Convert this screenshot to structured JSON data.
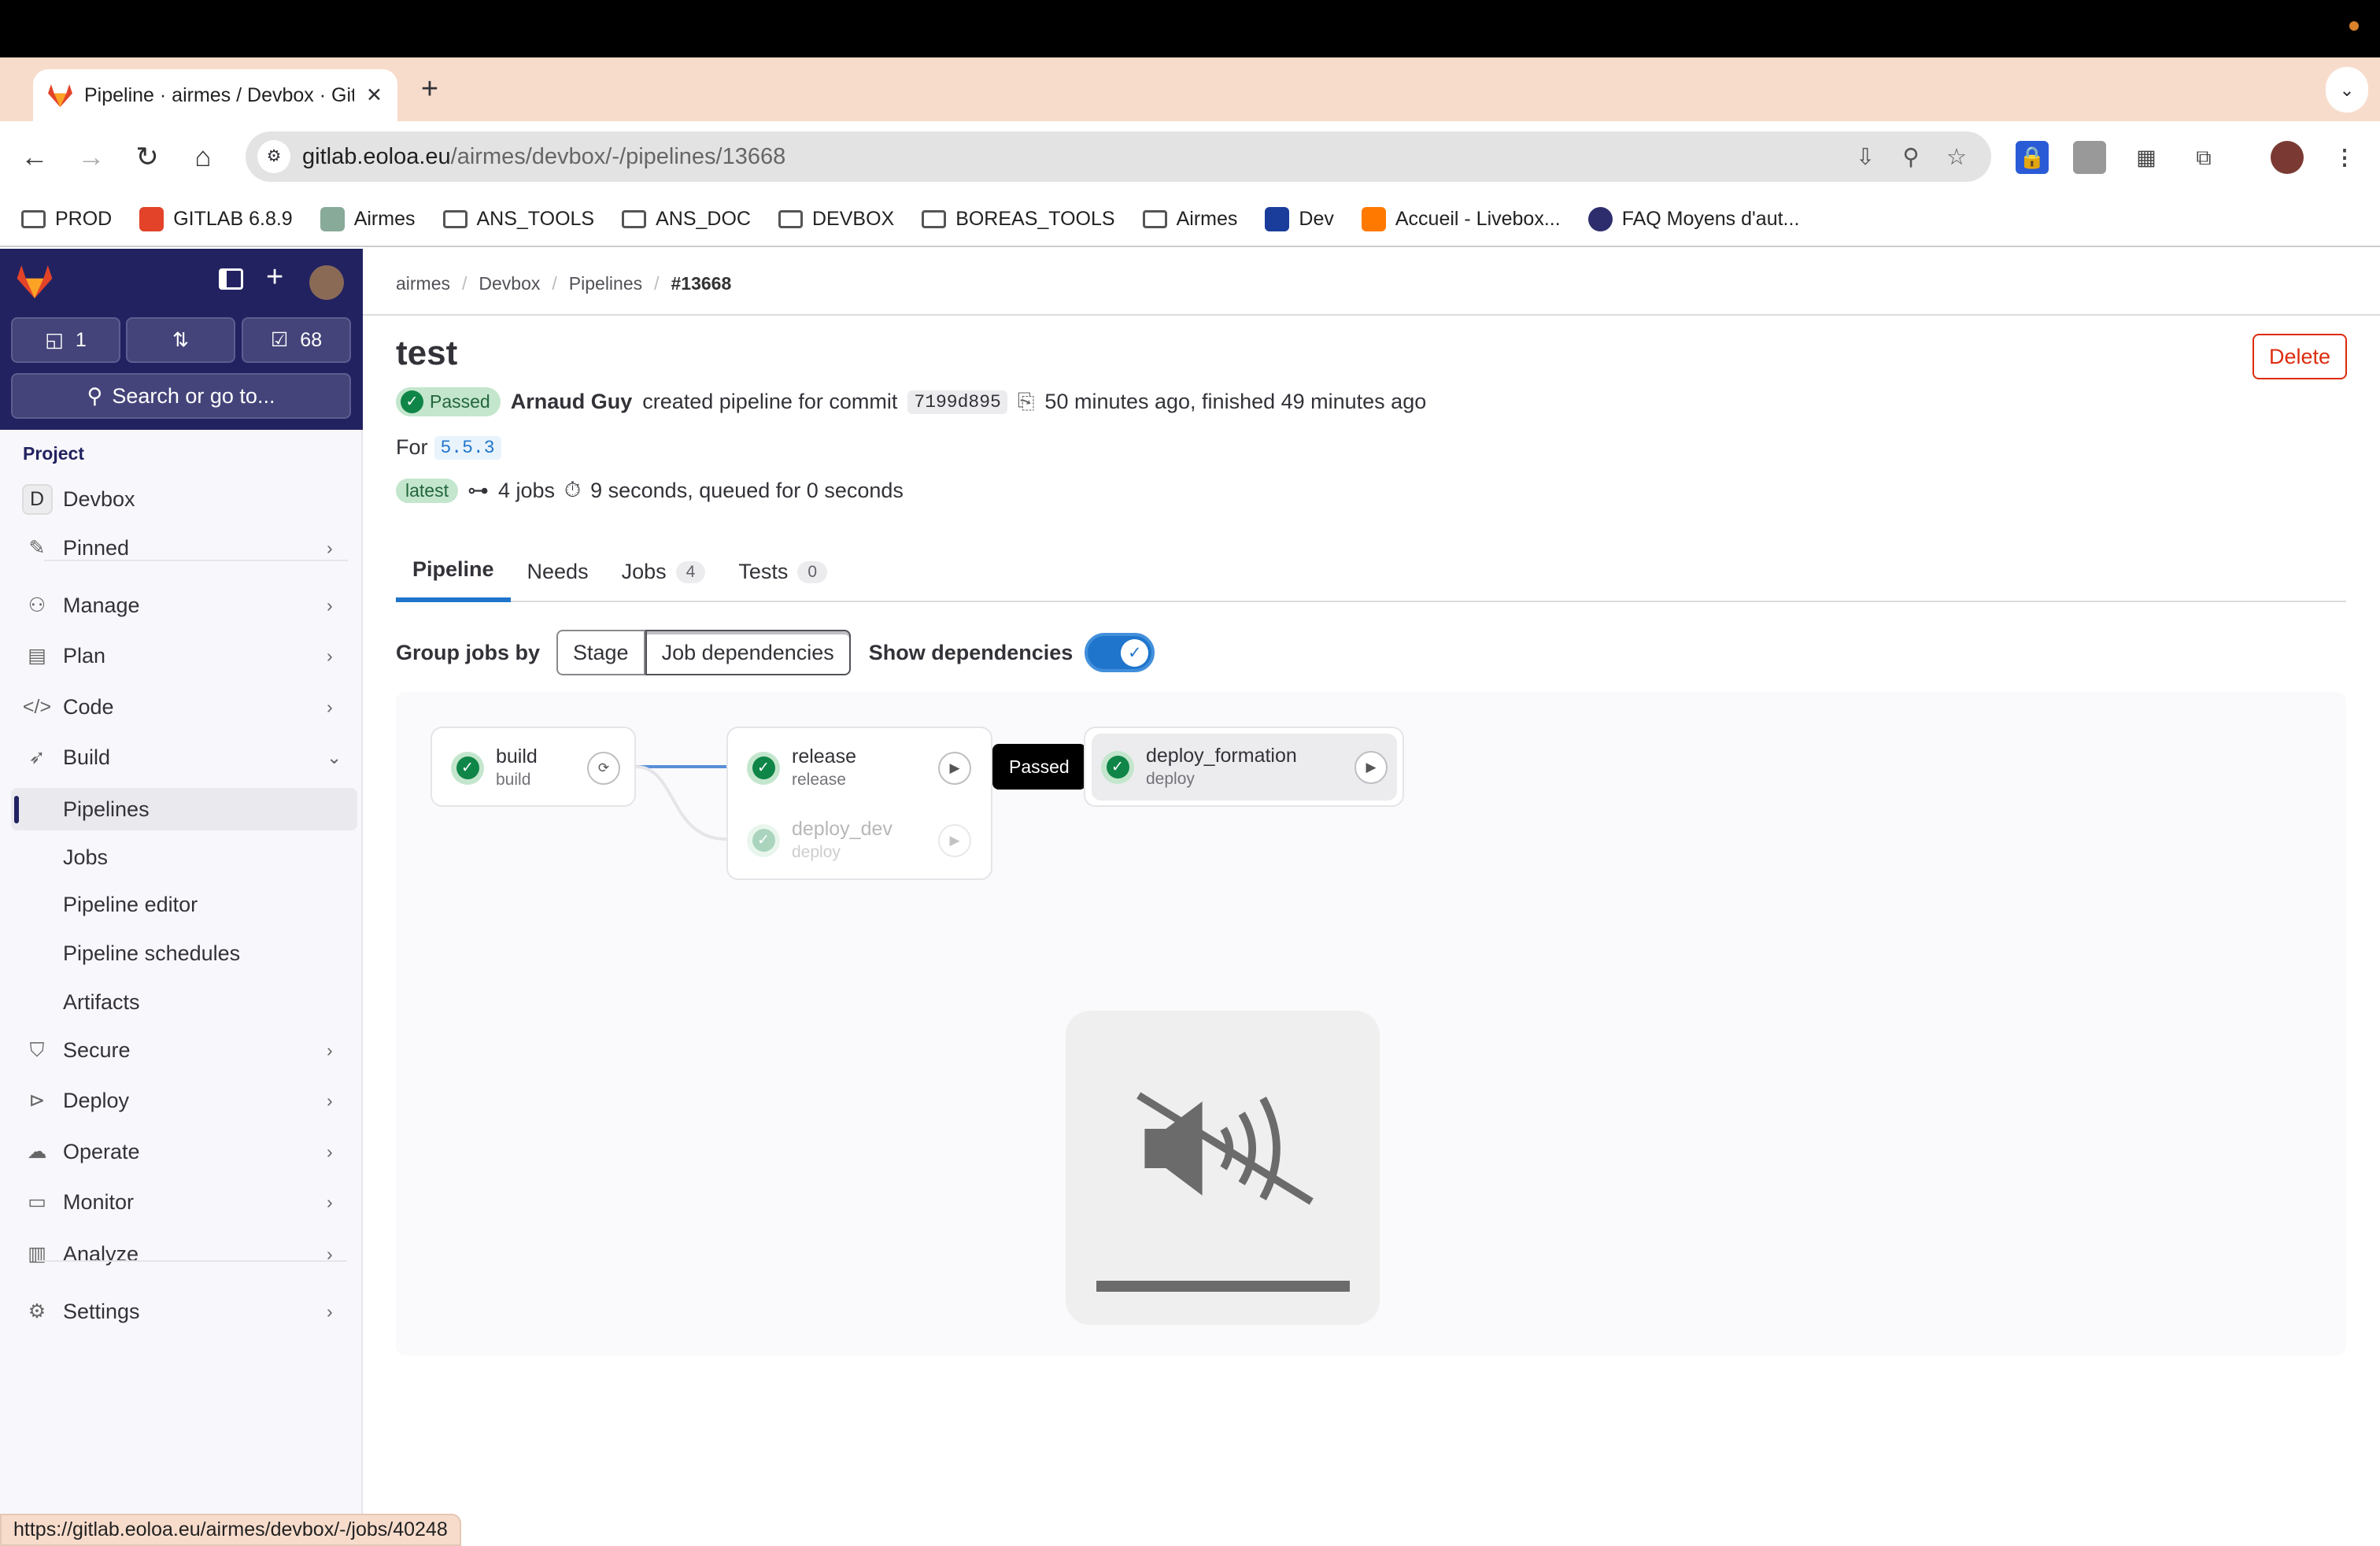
{
  "browser": {
    "tab_title": "Pipeline · airmes / Devbox · GitLab",
    "url_host": "gitlab.eoloa.eu",
    "url_path": "/airmes/devbox/-/pipelines/13668",
    "status_url": "https://gitlab.eoloa.eu/airmes/devbox/-/jobs/40248",
    "bookmarks": [
      {
        "label": "PROD",
        "icon": "folder-icon"
      },
      {
        "label": "GITLAB 6.8.9",
        "icon": "gitlab-icon"
      },
      {
        "label": "Airmes",
        "icon": "airmes-icon"
      },
      {
        "label": "ANS_TOOLS",
        "icon": "folder-icon"
      },
      {
        "label": "ANS_DOC",
        "icon": "folder-icon"
      },
      {
        "label": "DEVBOX",
        "icon": "folder-icon"
      },
      {
        "label": "BOREAS_TOOLS",
        "icon": "folder-icon"
      },
      {
        "label": "Airmes",
        "icon": "folder-icon"
      },
      {
        "label": "Dev",
        "icon": "dev-icon"
      },
      {
        "label": "Accueil - Livebox...",
        "icon": "orange-icon"
      },
      {
        "label": "FAQ Moyens d'aut...",
        "icon": "faq-icon"
      }
    ]
  },
  "sidebar": {
    "issues_count": "1",
    "todos_count": "68",
    "search_placeholder": "Search or go to...",
    "section": "Project",
    "project_initial": "D",
    "project_name": "Devbox",
    "items": [
      {
        "label": "Pinned",
        "icon": "pin-icon"
      },
      {
        "label": "Manage",
        "icon": "users-icon"
      },
      {
        "label": "Plan",
        "icon": "calendar-icon"
      },
      {
        "label": "Code",
        "icon": "code-icon"
      },
      {
        "label": "Build",
        "icon": "rocket-icon"
      },
      {
        "label": "Pipelines"
      },
      {
        "label": "Jobs"
      },
      {
        "label": "Pipeline editor"
      },
      {
        "label": "Pipeline schedules"
      },
      {
        "label": "Artifacts"
      },
      {
        "label": "Secure",
        "icon": "shield-icon"
      },
      {
        "label": "Deploy",
        "icon": "deploy-icon"
      },
      {
        "label": "Operate",
        "icon": "cloud-icon"
      },
      {
        "label": "Monitor",
        "icon": "monitor-icon"
      },
      {
        "label": "Analyze",
        "icon": "chart-icon"
      },
      {
        "label": "Settings",
        "icon": "gear-icon"
      }
    ]
  },
  "breadcrumb": [
    "airmes",
    "Devbox",
    "Pipelines",
    "#13668"
  ],
  "pipeline": {
    "title": "test",
    "delete_label": "Delete",
    "status": "Passed",
    "author": "Arnaud Guy",
    "created_text": "created pipeline for commit",
    "commit": "7199d895",
    "time_text": "50 minutes ago, finished 49 minutes ago",
    "for_label": "For",
    "ref": "5.5.3",
    "latest_label": "latest",
    "jobs_text": "4 jobs",
    "duration_text": "9 seconds, queued for 0 seconds"
  },
  "tabs": [
    {
      "label": "Pipeline"
    },
    {
      "label": "Needs"
    },
    {
      "label": "Jobs",
      "count": "4"
    },
    {
      "label": "Tests",
      "count": "0"
    }
  ],
  "controls": {
    "group_label": "Group jobs by",
    "stage": "Stage",
    "job_deps": "Job dependencies",
    "show_deps": "Show dependencies",
    "show_deps_on": true
  },
  "jobs": [
    {
      "name": "build",
      "stage": "build",
      "status": "passed",
      "action": "retry-icon"
    },
    {
      "name": "release",
      "stage": "release",
      "status": "passed",
      "action": "play-icon"
    },
    {
      "name": "deploy_dev",
      "stage": "deploy",
      "status": "passed",
      "action": "play-icon"
    },
    {
      "name": "deploy_formation",
      "stage": "deploy",
      "status": "passed",
      "action": "play-icon"
    }
  ],
  "tooltip": "Passed",
  "colors": {
    "sidebar": "#222261",
    "accent": "#1f75cb",
    "success": "#108548",
    "danger": "#dd2b0e"
  }
}
